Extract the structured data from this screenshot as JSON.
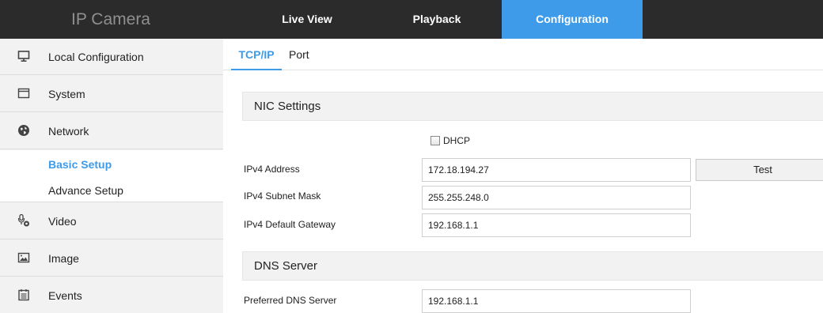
{
  "header": {
    "brand": "IP Camera",
    "nav": [
      {
        "label": "Live View"
      },
      {
        "label": "Playback"
      },
      {
        "label": "Configuration"
      }
    ],
    "active_nav": "Configuration",
    "accent_color": "#3d9be9"
  },
  "sidebar": {
    "items": [
      {
        "label": "Local Configuration",
        "icon": "monitor-icon"
      },
      {
        "label": "System",
        "icon": "window-icon"
      },
      {
        "label": "Network",
        "icon": "globe-icon"
      },
      {
        "label": "Video",
        "icon": "microphone-camera-icon"
      },
      {
        "label": "Image",
        "icon": "image-icon"
      },
      {
        "label": "Events",
        "icon": "calendar-icon"
      }
    ],
    "network_sub": [
      {
        "label": "Basic Setup"
      },
      {
        "label": "Advance Setup"
      }
    ],
    "active_sub": "Basic Setup"
  },
  "tabs": [
    {
      "label": "TCP/IP"
    },
    {
      "label": "Port"
    }
  ],
  "active_tab": "TCP/IP",
  "nic_settings": {
    "title": "NIC Settings",
    "dhcp_label": "DHCP",
    "dhcp_checked": false,
    "test_button": "Test",
    "fields": [
      {
        "label": "IPv4 Address",
        "value": "172.18.194.27"
      },
      {
        "label": "IPv4 Subnet Mask",
        "value": "255.255.248.0"
      },
      {
        "label": "IPv4 Default Gateway",
        "value": "192.168.1.1"
      }
    ]
  },
  "dns_server": {
    "title": "DNS Server",
    "fields": [
      {
        "label": "Preferred DNS Server",
        "value": "192.168.1.1"
      }
    ]
  }
}
